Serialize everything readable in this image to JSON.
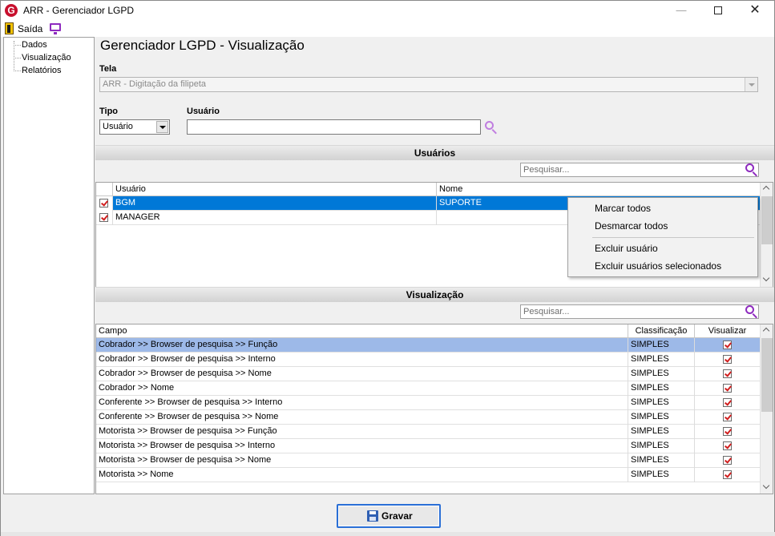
{
  "window": {
    "title": "ARR - Gerenciador LGPD",
    "minimize_glyph": "—",
    "close_glyph": "✕"
  },
  "menubar": {
    "exit_label": "Saída"
  },
  "sidebar": {
    "items": [
      {
        "label": "Dados"
      },
      {
        "label": "Visualização"
      },
      {
        "label": "Relatórios"
      }
    ]
  },
  "main": {
    "heading": "Gerenciador LGPD - Visualização",
    "tela_label": "Tela",
    "tela_value": "ARR - Digitação da filipeta",
    "tipo_label": "Tipo",
    "tipo_value": "Usuário",
    "usuario_label": "Usuário",
    "usuario_value": ""
  },
  "users_section": {
    "title": "Usuários",
    "search_placeholder": "Pesquisar...",
    "columns": [
      "Usuário",
      "Nome"
    ],
    "rows": [
      {
        "checked": true,
        "usuario": "BGM",
        "nome": "SUPORTE",
        "selected": true
      },
      {
        "checked": true,
        "usuario": "MANAGER",
        "nome": "",
        "selected": false
      }
    ]
  },
  "context_menu": {
    "items": [
      {
        "label": "Marcar todos"
      },
      {
        "label": "Desmarcar todos"
      },
      {
        "label": "Excluir usuário"
      },
      {
        "label": "Excluir usuários selecionados"
      }
    ]
  },
  "view_section": {
    "title": "Visualização",
    "search_placeholder": "Pesquisar...",
    "columns": [
      "Campo",
      "Classificação",
      "Visualizar"
    ],
    "rows": [
      {
        "campo": "Cobrador >> Browser de pesquisa >> Função",
        "classificacao": "SIMPLES",
        "visualizar": true
      },
      {
        "campo": "Cobrador >> Browser de pesquisa >> Interno",
        "classificacao": "SIMPLES",
        "visualizar": true
      },
      {
        "campo": "Cobrador >> Browser de pesquisa >> Nome",
        "classificacao": "SIMPLES",
        "visualizar": true
      },
      {
        "campo": "Cobrador >> Nome",
        "classificacao": "SIMPLES",
        "visualizar": true
      },
      {
        "campo": "Conferente >> Browser de pesquisa >> Interno",
        "classificacao": "SIMPLES",
        "visualizar": true
      },
      {
        "campo": "Conferente >> Browser de pesquisa >> Nome",
        "classificacao": "SIMPLES",
        "visualizar": true
      },
      {
        "campo": "Motorista >> Browser de pesquisa >> Função",
        "classificacao": "SIMPLES",
        "visualizar": true
      },
      {
        "campo": "Motorista >> Browser de pesquisa >> Interno",
        "classificacao": "SIMPLES",
        "visualizar": true
      },
      {
        "campo": "Motorista >> Browser de pesquisa >> Nome",
        "classificacao": "SIMPLES",
        "visualizar": true
      },
      {
        "campo": "Motorista >> Nome",
        "classificacao": "SIMPLES",
        "visualizar": true
      }
    ]
  },
  "footer": {
    "save_label": "Gravar"
  },
  "colors": {
    "brand_red": "#c8102e",
    "accent_purple": "#8e2bbf",
    "selected_user_row": "#0078d7",
    "selected_view_row": "#9db9e8",
    "check_red": "#d01f1f"
  }
}
